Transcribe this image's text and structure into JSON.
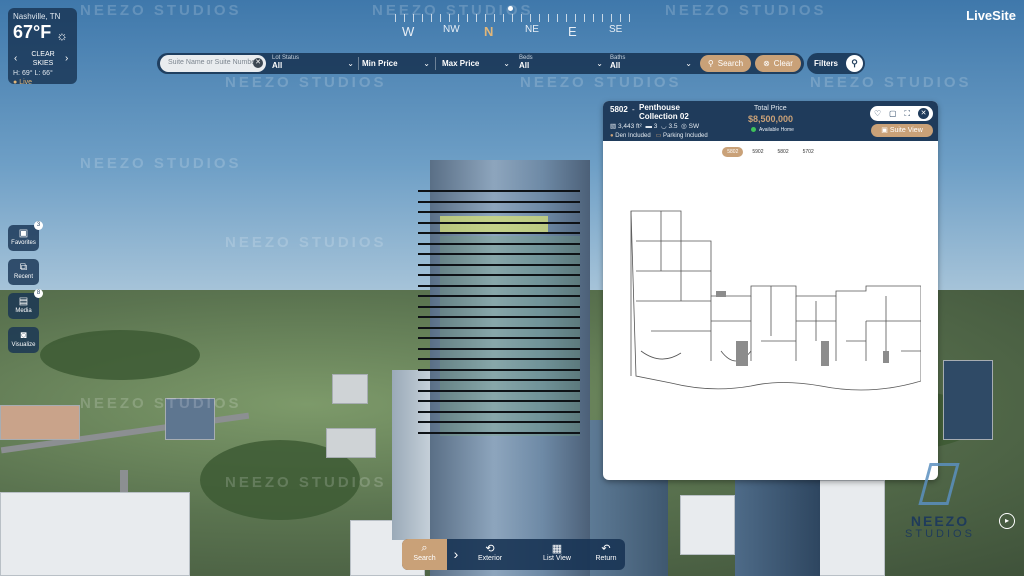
{
  "watermark": "NEEZO STUDIOS",
  "compass": {
    "labels": [
      "W",
      "NW",
      "N",
      "NE",
      "E",
      "SE"
    ]
  },
  "weather": {
    "city": "Nashville, TN",
    "temp": "67°F",
    "condition_line1": "CLEAR",
    "condition_line2": "SKIES",
    "high_low": "H: 69°   L: 66°",
    "live": "Live"
  },
  "logo": {
    "text": "LiveSite",
    "tagline": ""
  },
  "filters": {
    "search_placeholder": "Suite Name or Suite Number",
    "lot_status": {
      "caption": "Lot Status",
      "value": "All"
    },
    "min_price": {
      "value": "Min Price"
    },
    "max_price": {
      "value": "Max Price"
    },
    "beds": {
      "caption": "Beds",
      "value": "All"
    },
    "baths": {
      "caption": "Baths",
      "value": "All"
    },
    "search_label": "Search",
    "clear_label": "Clear",
    "filters_label": "Filters"
  },
  "rail": [
    {
      "label": "Favorites",
      "badge": "3",
      "icon": "favorites-icon"
    },
    {
      "label": "Recent",
      "badge": "",
      "icon": "recent-icon"
    },
    {
      "label": "Media",
      "badge": "8",
      "icon": "media-icon"
    },
    {
      "label": "Visualize",
      "badge": "",
      "icon": "camera-icon"
    }
  ],
  "unit": {
    "number": "5802",
    "name": "Penthouse Collection 02",
    "sqft": "3,443 ft²",
    "beds": "3",
    "baths": "3.5",
    "exposure": "SW",
    "den": "Den Included",
    "parking": "Parking Included",
    "price_caption": "Total Price",
    "price": "$8,500,000",
    "availability": "Available Home",
    "suite_view_label": "Suite View",
    "plan_tabs": [
      "5802",
      "5902",
      "5802",
      "5702"
    ]
  },
  "bottom_bar": {
    "search": "Search",
    "exterior": "Exterior",
    "list_view": "List View",
    "return": "Return"
  },
  "brand": {
    "line1": "NEEZO",
    "line2": "STUDIOS"
  }
}
